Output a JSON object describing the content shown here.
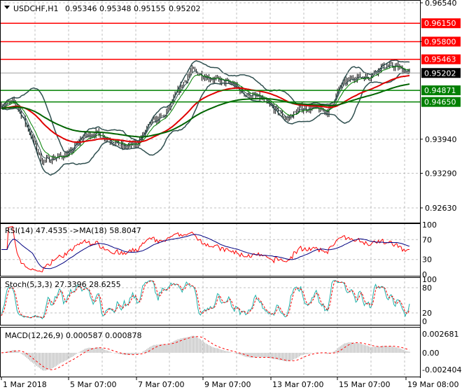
{
  "header": {
    "symbol": "USDCHF,H1",
    "open": "0.95346",
    "high": "0.95348",
    "low": "0.95155",
    "close": "0.95202"
  },
  "price_scale": {
    "ticks": [
      "0.96540",
      "0.95800",
      "0.93940",
      "0.93290",
      "0.92630"
    ],
    "tick_values": [
      0.9654,
      0.958,
      0.9394,
      0.9329,
      0.9263
    ],
    "range": [
      0.9263,
      0.9654
    ]
  },
  "levels": [
    {
      "label": "0.96150",
      "value": 0.9615,
      "color": "#ff0000"
    },
    {
      "label": "0.95800",
      "value": 0.958,
      "color": "#ff0000"
    },
    {
      "label": "0.95463",
      "value": 0.95463,
      "color": "#ff0000"
    },
    {
      "label": "0.94871",
      "value": 0.94871,
      "color": "#008000"
    },
    {
      "label": "0.94650",
      "value": 0.9465,
      "color": "#008000"
    }
  ],
  "current_price": {
    "label": "0.95202",
    "value": 0.95202,
    "color": "#000000"
  },
  "price_path": [
    0.9459,
    0.9466,
    0.9412,
    0.9352,
    0.9359,
    0.9366,
    0.9399,
    0.9406,
    0.9392,
    0.9379,
    0.9386,
    0.9426,
    0.9439,
    0.9486,
    0.9526,
    0.9513,
    0.9506,
    0.9499,
    0.9479,
    0.9473,
    0.9453,
    0.9432,
    0.9453,
    0.9453,
    0.9446,
    0.9499,
    0.9513,
    0.9513,
    0.9533,
    0.9533,
    0.952
  ],
  "rsi": {
    "label": "RSI(14) 47.4535  ->MA(18) 58.8047",
    "ticks": [
      "100",
      "70",
      "30",
      "0"
    ],
    "color": "#ff0000",
    "ma_color": "#000080"
  },
  "stoch": {
    "label": "Stoch(5,3,3) 27.3396 28.6255",
    "ticks": [
      "100",
      "80",
      "20",
      "0"
    ],
    "main_color": "#20b2aa",
    "signal_color": "#ff0000"
  },
  "macd": {
    "label": "MACD(12,26,9) 0.000587 0.000878",
    "ticks": [
      "0.002681",
      "0.00",
      "-0.002404"
    ]
  },
  "time_axis": [
    "1 Mar 2018",
    "5 Mar 07:00",
    "7 Mar 07:00",
    "9 Mar 07:00",
    "13 Mar 07:00",
    "15 Mar 07:00",
    "19 Mar 08:00"
  ]
}
